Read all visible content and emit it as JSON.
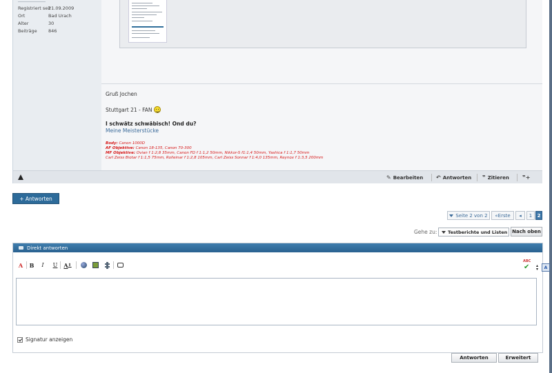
{
  "user_info": {
    "rows": [
      {
        "key": "Registriert seit",
        "value": "21.09.2009"
      },
      {
        "key": "Ort",
        "value": "Bad Urach"
      },
      {
        "key": "Alter",
        "value": "30"
      },
      {
        "key": "Beiträge",
        "value": "846"
      }
    ]
  },
  "signature": {
    "greeting": "Gruß Jochen",
    "stuttgart": "Stuttgart 21 - FAN",
    "slogan": "I schwätz schwäbisch! Ond du?",
    "link": "Meine Meisterstücke",
    "gear": [
      {
        "label": "Body:",
        "value": " Canon 1000D"
      },
      {
        "label": "AF Objektive:",
        "value": " Canon 18-135, Canon 70-300"
      },
      {
        "label": "MF Objektive:",
        "value": " Ovian f 1:2,8 35mm, Canon FD f 1:1,2 50mm, Nikkor-S f1:1,4 50mm, Yashica f 1:1,7 50mm"
      },
      {
        "label": "",
        "value": "Carl Zeiss Biotar f 1:1,5 75mm, Rolleinar f 1:2,8 105mm, Carl Zeiss Sonnar f 1:4,0 135mm, Reynox f 1:3,5 200mm"
      }
    ]
  },
  "post_actions": {
    "edit": "Bearbeiten",
    "reply": "Antworten",
    "quote": "Zitieren"
  },
  "reply_button": "+ Antworten",
  "pagination": {
    "page_of": "Seite 2 von 2",
    "first": "Erste",
    "pages": [
      "1",
      "2"
    ]
  },
  "goto": {
    "label": "Gehe zu:",
    "selected": "Testberichte und Listen",
    "button": "Nach oben"
  },
  "quick_reply": {
    "title": "Direkt antworten",
    "toolbar": {
      "bold": "B",
      "italic": "I",
      "underline": "U",
      "color": "A"
    },
    "show_signature": "Signatur anzeigen",
    "submit": "Antworten",
    "advanced": "Erweitert"
  },
  "colors": {
    "accent": "#2d6b9a",
    "signature_red": "#d61414",
    "link": "#3a6a99"
  }
}
